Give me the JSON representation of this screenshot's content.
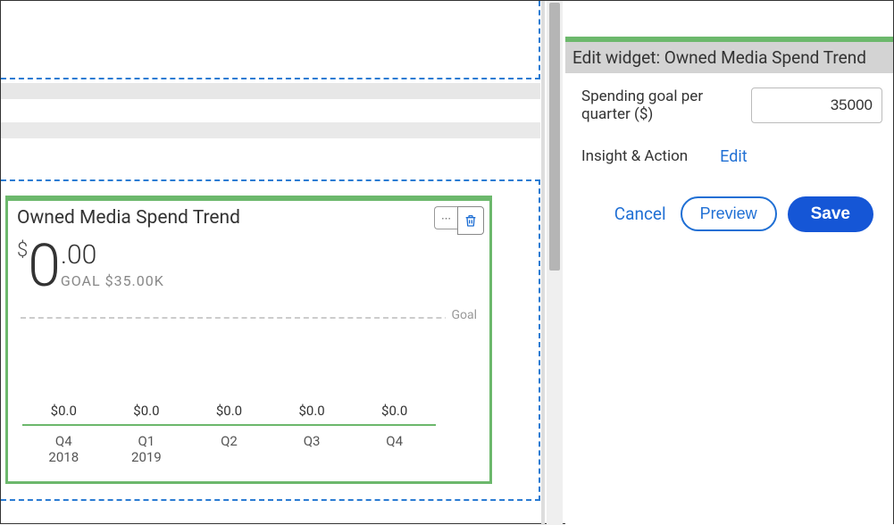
{
  "widget": {
    "title": "Owned Media Spend Trend",
    "currency_symbol": "$",
    "value_whole": "0",
    "value_cents": ".00",
    "goal_label": "GOAL $35.00K",
    "goal_line_label": "Goal"
  },
  "chart_data": {
    "type": "bar",
    "categories": [
      "Q4",
      "Q1",
      "Q2",
      "Q3",
      "Q4"
    ],
    "year_labels": [
      "2018",
      "2019",
      "",
      "",
      ""
    ],
    "value_labels": [
      "$0.0",
      "$0.0",
      "$0.0",
      "$0.0",
      "$0.0"
    ],
    "values": [
      0,
      0,
      0,
      0,
      0
    ],
    "goal": 35000,
    "xlabel": "",
    "ylabel": "",
    "title": "Owned Media Spend Trend"
  },
  "panel": {
    "header": "Edit widget: Owned Media Spend Trend",
    "spending_label": "Spending goal per quarter ($)",
    "spending_value": "35000",
    "insight_label": "Insight & Action",
    "edit_link": "Edit",
    "cancel": "Cancel",
    "preview": "Preview",
    "save": "Save"
  }
}
